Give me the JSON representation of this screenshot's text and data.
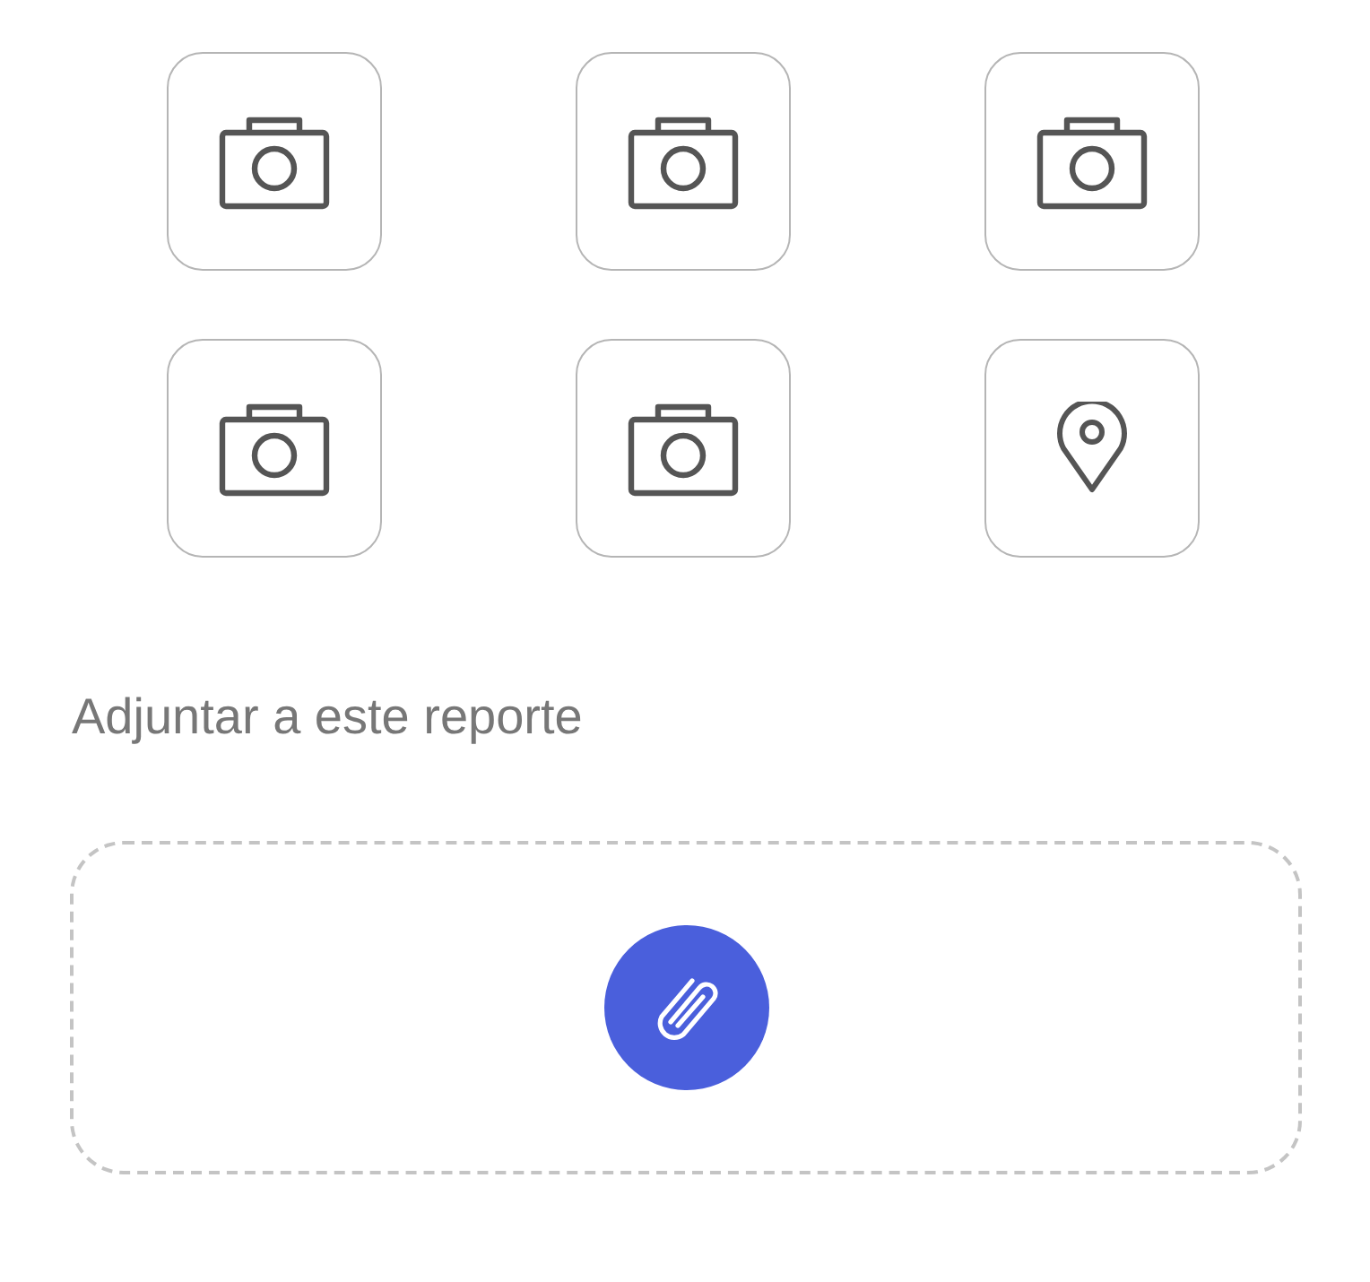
{
  "tiles": [
    {
      "kind": "camera"
    },
    {
      "kind": "camera"
    },
    {
      "kind": "camera"
    },
    {
      "kind": "camera"
    },
    {
      "kind": "camera"
    },
    {
      "kind": "location"
    }
  ],
  "attach": {
    "label": "Adjuntar a este reporte"
  }
}
